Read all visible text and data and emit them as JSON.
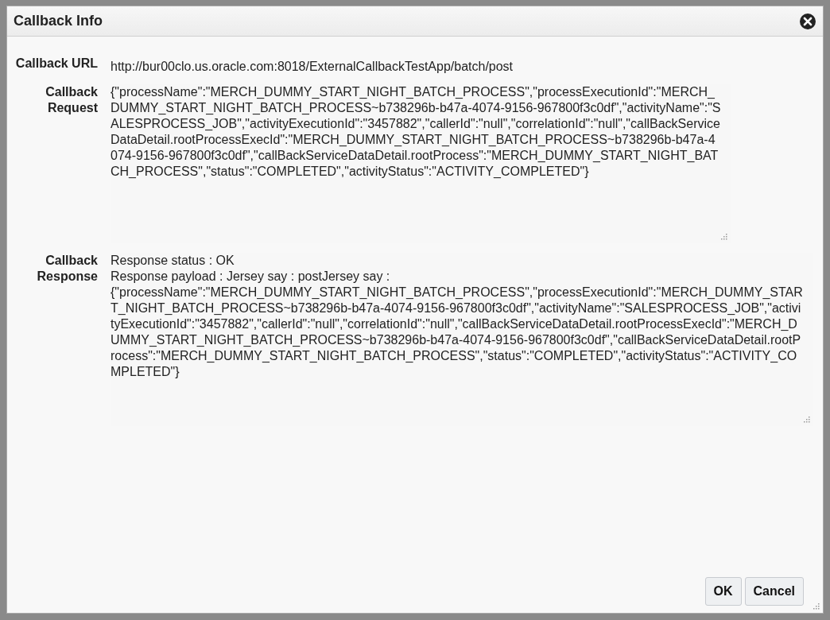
{
  "dialog": {
    "title": "Callback Info",
    "fields": [
      {
        "label": "Callback URL",
        "kind": "text",
        "lines": [
          "http://bur00clo.us.oracle.com:8018/ExternalCallbackTestApp/batch/post"
        ]
      },
      {
        "label": "Callback Request",
        "kind": "area",
        "lines": [
          "{\"processName\":\"MERCH_DUMMY_START_NIGHT_BATCH_PROCESS\",\"processExecutionId\":\"MERCH_DUMMY_START_NIGHT_BATCH_PROCESS~b738296b-b47a-4074-9156-967800f3c0df\",\"activityName\":\"SALESPROCESS_JOB\",\"activityExecutionId\":\"3457882\",\"callerId\":\"null\",\"correlationId\":\"null\",\"callBackServiceDataDetail.rootProcessExecId\":\"MERCH_DUMMY_START_NIGHT_BATCH_PROCESS~b738296b-b47a-4074-9156-967800f3c0df\",\"callBackServiceDataDetail.rootProcess\":\"MERCH_DUMMY_START_NIGHT_BATCH_PROCESS\",\"status\":\"COMPLETED\",\"activityStatus\":\"ACTIVITY_COMPLETED\"}"
        ]
      },
      {
        "label": "Callback Response",
        "kind": "area",
        "lines": [
          "Response status : OK",
          "Response payload : Jersey say : postJersey say :",
          "{\"processName\":\"MERCH_DUMMY_START_NIGHT_BATCH_PROCESS\",\"processExecutionId\":\"MERCH_DUMMY_START_NIGHT_BATCH_PROCESS~b738296b-b47a-4074-9156-967800f3c0df\",\"activityName\":\"SALESPROCESS_JOB\",\"activityExecutionId\":\"3457882\",\"callerId\":\"null\",\"correlationId\":\"null\",\"callBackServiceDataDetail.rootProcessExecId\":\"MERCH_DUMMY_START_NIGHT_BATCH_PROCESS~b738296b-b47a-4074-9156-967800f3c0df\",\"callBackServiceDataDetail.rootProcess\":\"MERCH_DUMMY_START_NIGHT_BATCH_PROCESS\",\"status\":\"COMPLETED\",\"activityStatus\":\"ACTIVITY_COMPLETED\"}"
        ]
      }
    ],
    "buttons": [
      "OK",
      "Cancel"
    ]
  }
}
